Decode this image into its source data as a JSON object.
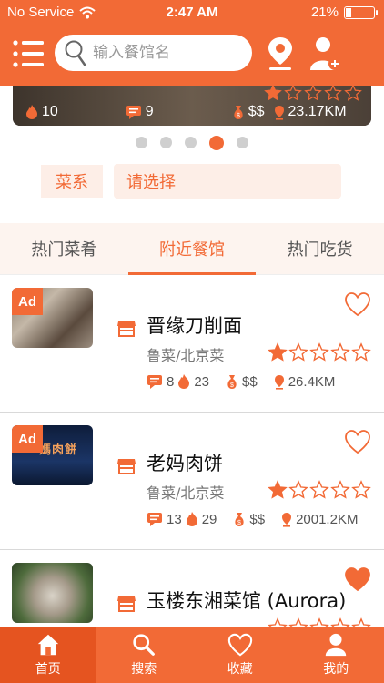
{
  "status_bar": {
    "carrier": "No Service",
    "time": "2:47 AM",
    "battery": "21%",
    "battery_level": 0.21
  },
  "header": {
    "search_placeholder": "输入餐馆名"
  },
  "carousel": {
    "rating": 1,
    "max_rating": 5,
    "hot_count": "10",
    "comment_count": "9",
    "price": "$$",
    "distance": "23.17KM",
    "page_count": 5,
    "active_page": 4
  },
  "filter": {
    "label": "菜系",
    "select_value": "请选择"
  },
  "tabs": [
    {
      "label": "热门菜肴",
      "active": false
    },
    {
      "label": "附近餐馆",
      "active": true
    },
    {
      "label": "热门吃货",
      "active": false
    }
  ],
  "restaurants": [
    {
      "ad_label": "Ad",
      "name": "晋缘刀削面",
      "cuisine": "鲁菜/北京菜",
      "rating": 1,
      "max_rating": 5,
      "comments": "8",
      "hot": "23",
      "price": "$$",
      "distance": "26.4KM",
      "favorited": false
    },
    {
      "ad_label": "Ad",
      "name": "老妈肉饼",
      "cuisine": "鲁菜/北京菜",
      "rating": 1,
      "max_rating": 5,
      "comments": "13",
      "hot": "29",
      "price": "$$",
      "distance": "2001.2KM",
      "favorited": false,
      "sign_text": "媽肉餅"
    },
    {
      "ad_label": "",
      "name": "玉楼东湘菜馆 (Aurora)",
      "cuisine": "",
      "rating": 0,
      "max_rating": 5,
      "favorited": true
    }
  ],
  "bottom_nav": [
    {
      "label": "首页",
      "icon": "home-icon",
      "active": true
    },
    {
      "label": "搜索",
      "icon": "search-icon",
      "active": false
    },
    {
      "label": "收藏",
      "icon": "heart-icon",
      "active": false
    },
    {
      "label": "我的",
      "icon": "user-icon",
      "active": false
    }
  ],
  "colors": {
    "accent": "#f26a36",
    "accent_dark": "#e55420",
    "tint": "#fdeee7"
  }
}
